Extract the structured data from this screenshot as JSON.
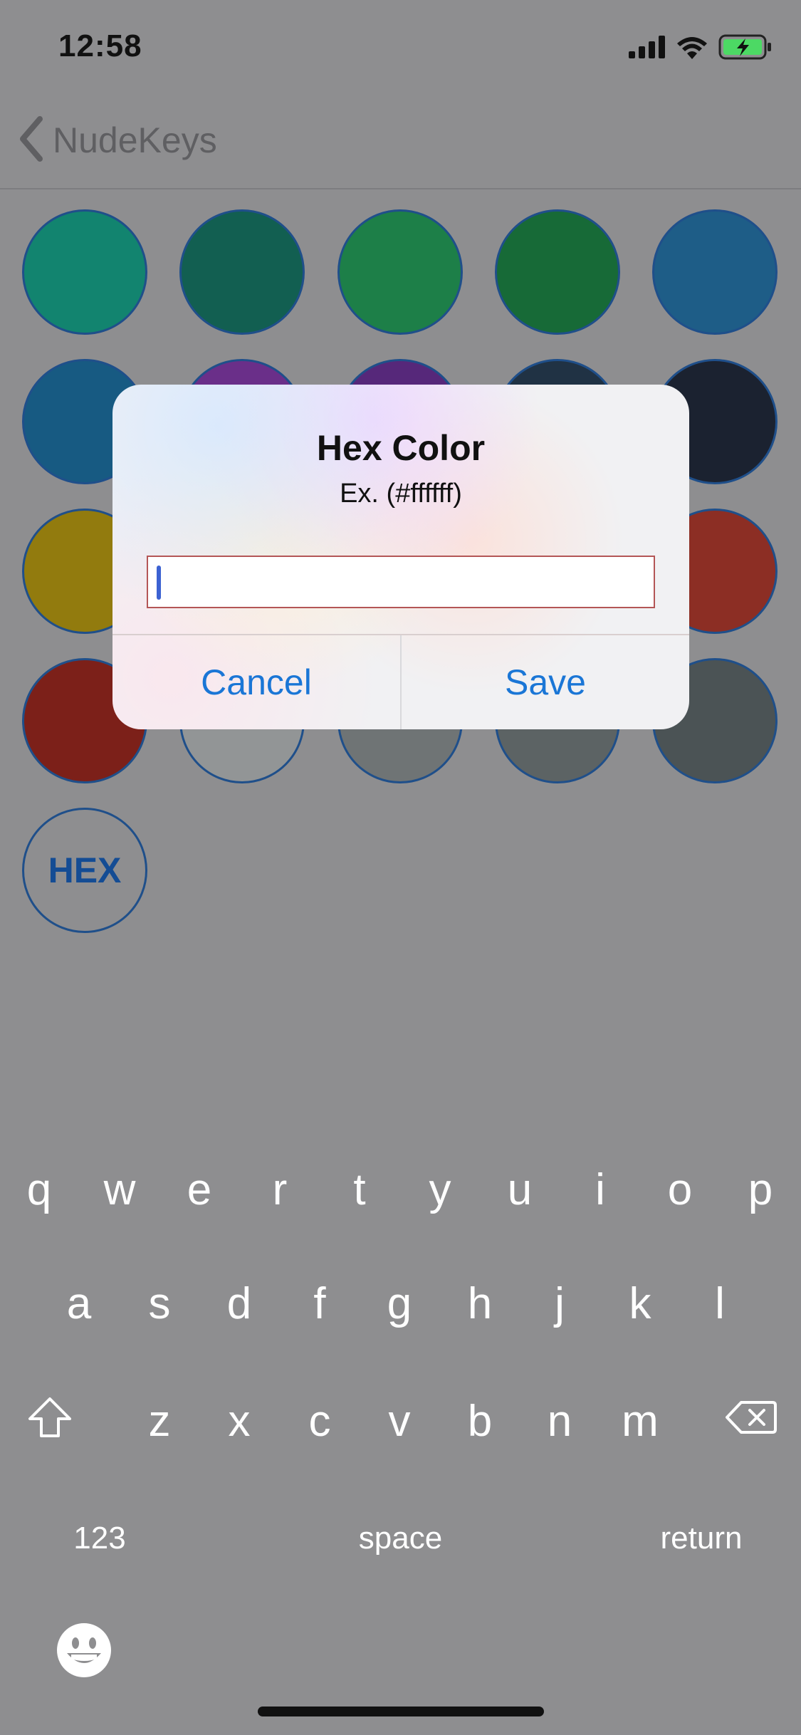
{
  "status_bar": {
    "time": "12:58",
    "icons": [
      "signal-icon",
      "wifi-icon",
      "battery-charging-icon"
    ]
  },
  "nav": {
    "back_label": "NudeKeys"
  },
  "swatches": [
    {
      "color": "#12846f"
    },
    {
      "color": "#125f51"
    },
    {
      "color": "#1d7f48"
    },
    {
      "color": "#176a37"
    },
    {
      "color": "#1e5d87"
    },
    {
      "color": "#175a82"
    },
    {
      "color": "#6a2f89"
    },
    {
      "color": "#56287a"
    },
    {
      "color": "#203244"
    },
    {
      "color": "#1b2230"
    },
    {
      "color": "#927b0e"
    },
    {
      "color": "#8d6a0e"
    },
    {
      "color": "#855207"
    },
    {
      "color": "#7c3d20"
    },
    {
      "color": "#8c2e24"
    },
    {
      "color": "#7c2019"
    },
    {
      "color": "#929596"
    },
    {
      "color": "#6f7475"
    },
    {
      "color": "#5c6364"
    },
    {
      "color": "#4b5355"
    }
  ],
  "hex_button": {
    "label": "HEX"
  },
  "alert": {
    "title": "Hex Color",
    "subtitle": "Ex. (#ffffff)",
    "input_value": "",
    "input_placeholder": "",
    "cancel_label": "Cancel",
    "save_label": "Save"
  },
  "keyboard": {
    "row1": [
      "q",
      "w",
      "e",
      "r",
      "t",
      "y",
      "u",
      "i",
      "o",
      "p"
    ],
    "row2": [
      "a",
      "s",
      "d",
      "f",
      "g",
      "h",
      "j",
      "k",
      "l"
    ],
    "row3": [
      "z",
      "x",
      "c",
      "v",
      "b",
      "n",
      "m"
    ],
    "numbers_label": "123",
    "space_label": "space",
    "return_label": "return"
  },
  "colors": {
    "tint": "#1a76d6",
    "dim_background": "#8e8e90"
  }
}
